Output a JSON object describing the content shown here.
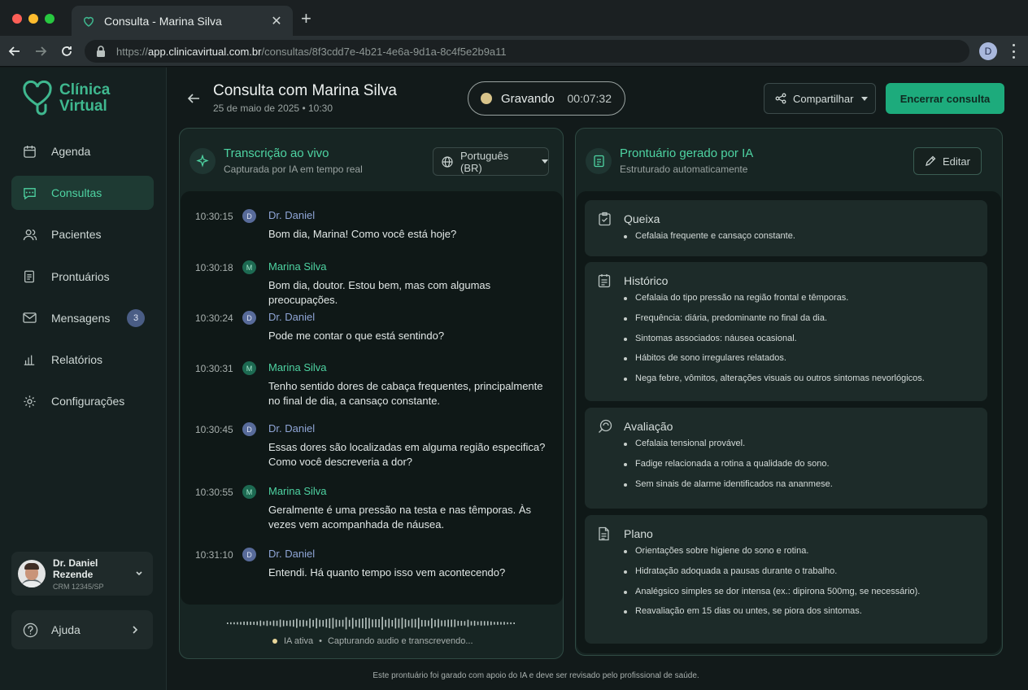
{
  "browser": {
    "tab_title": "Consulta - Marina Silva",
    "url_scheme": "https://",
    "url_host": "app.clinicavirtual.com.br",
    "url_path": "/consultas/8f3cdd7e-4b21-4e6a-9d1a-8c4f5e2b9a11",
    "profile_initial": "D"
  },
  "brand": {
    "line1": "Clínica",
    "line2": "Virtual"
  },
  "sidebar": {
    "items": [
      {
        "label": "Agenda",
        "icon": "calendar-icon"
      },
      {
        "label": "Consultas",
        "icon": "chat-icon",
        "active": true
      },
      {
        "label": "Pacientes",
        "icon": "users-icon"
      },
      {
        "label": "Prontuários",
        "icon": "clipboard-icon"
      },
      {
        "label": "Mensagens",
        "icon": "mail-icon",
        "badge": "3"
      },
      {
        "label": "Relatórios",
        "icon": "bar-chart-icon"
      },
      {
        "label": "Configurações",
        "icon": "gear-icon"
      }
    ],
    "user": {
      "name": "Dr. Daniel Rezende",
      "crm": "CRM 12345/SP"
    },
    "help_label": "Ajuda"
  },
  "header": {
    "title": "Consulta com Marina Silva",
    "date": "25 de maio de 2025",
    "time": "10:30",
    "recording_label": "Gravando",
    "recording_time": "00:07:32",
    "share_label": "Compartilhar",
    "end_label": "Encerrar consulta"
  },
  "transcript": {
    "title": "Transcrição ao vivo",
    "subtitle": "Capturada por IA em tempo real",
    "language": "Português (BR)",
    "messages": [
      {
        "time": "10:30:15",
        "initial": "D",
        "speaker": "Dr. Daniel",
        "role": "dr",
        "text": "Bom dia, Marina! Como você está hoje?"
      },
      {
        "time": "10:30:18",
        "initial": "M",
        "speaker": "Marina Silva",
        "role": "pt",
        "text": "Bom dia, doutor. Estou bem, mas com algumas preocupações."
      },
      {
        "time": "10:30:24",
        "initial": "D",
        "speaker": "Dr. Daniel",
        "role": "dr",
        "text": "Pode me contar o que está sentindo?"
      },
      {
        "time": "10:30:31",
        "initial": "M",
        "speaker": "Marina Silva",
        "role": "pt",
        "text": "Tenho sentido dores de cabaça frequentes, principalmente no final de dia, a cansaço constante."
      },
      {
        "time": "10:30:45",
        "initial": "D",
        "speaker": "Dr. Daniel",
        "role": "dr",
        "text": "Essas dores são localizadas em alguma região especifica? Como você descreveria a dor?"
      },
      {
        "time": "10:30:55",
        "initial": "M",
        "speaker": "Marina Silva",
        "role": "pt",
        "text": "Geralmente é uma pressão na testa e nas têmporas. Às vezes vem acompanhada de náusea."
      },
      {
        "time": "10:31:10",
        "initial": "D",
        "speaker": "Dr. Daniel",
        "role": "dr",
        "text": "Entendi. Há quanto tempo isso vem acontecendo?"
      }
    ],
    "status_label": "IA ativa",
    "status_detail": "Capturando audio e transcrevendo..."
  },
  "record": {
    "title": "Prontuário gerado por IA",
    "subtitle": "Estruturado automaticamente",
    "edit_label": "Editar",
    "sections": [
      {
        "title": "Queixa",
        "icon": "clipboard-check-icon",
        "items": [
          "Cefalaia frequente e cansaço constante."
        ]
      },
      {
        "title": "Histórico",
        "icon": "list-icon",
        "items": [
          "Cefalaia do tipo pressão na região frontal e têmporas.",
          "Frequência: diária, predominante no final da dia.",
          "Sintomas associados: náusea ocasional.",
          "Hábitos de sono irregulares relatados.",
          "Nega febre, vômitos, alterações visuais ou outros sintomas nevorlógicos."
        ]
      },
      {
        "title": "Avaliação",
        "icon": "stethoscope-icon",
        "items": [
          "Cefalaia tensional provável.",
          "Fadige relacionada a rotina a qualidade do sono.",
          "Sem sinais de alarme identificados na ananmese."
        ]
      },
      {
        "title": "Plano",
        "icon": "document-icon",
        "items": [
          "Orientações sobre higiene do sono e rotina.",
          "Hidratação adoquada a pausas durante o trabalho.",
          "Analégsico simples se dor intensa (ex.: dipirona 500mg, se necessário).",
          "Reavaliação em 15 dias ou untes, se piora dos sintomas."
        ]
      }
    ]
  },
  "footer_note": "Este prontuário foi garado com apoio do IA e deve ser revisado pelo profissional de saúde.",
  "colors": {
    "accent": "#1dab7c",
    "accent_text": "#4ed3a2",
    "doctor": "#8fa5d6"
  }
}
